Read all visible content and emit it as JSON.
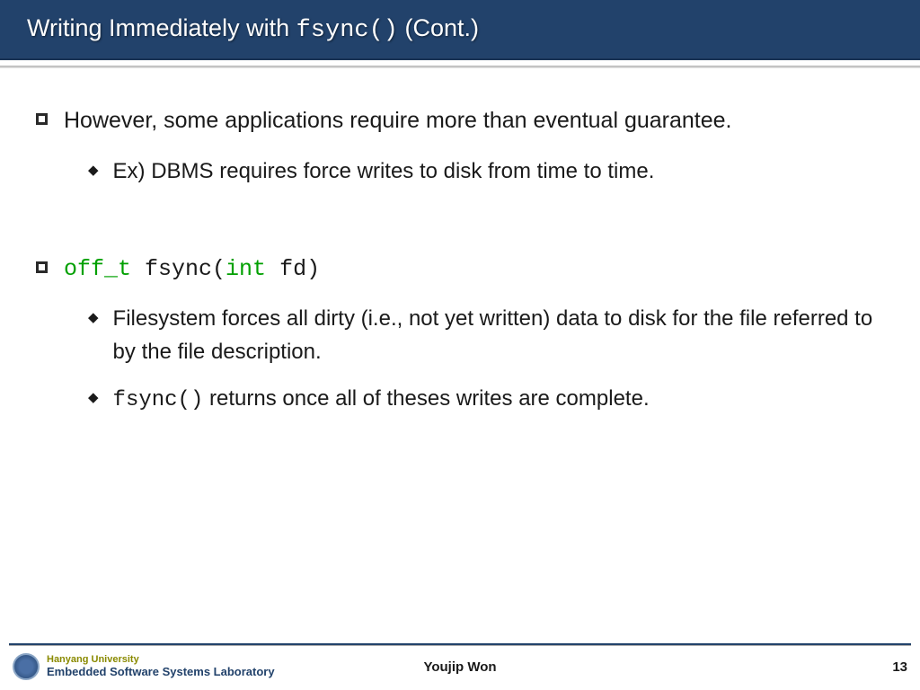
{
  "header": {
    "title_pre": "Writing Immediately with ",
    "title_code": "fsync()",
    "title_post": "  (Cont.)"
  },
  "content": {
    "item1": {
      "text": "However, some applications require more than eventual guarantee.",
      "sub1": "Ex) DBMS requires force writes to disk from time to time."
    },
    "item2": {
      "sig_type": "off_t",
      "sig_func": " fsync(",
      "sig_param_type": "int",
      "sig_rest": " fd)",
      "sub1": "Filesystem forces all dirty (i.e., not yet written) data to disk for the file referred to by the file description.",
      "sub2_code": "fsync()",
      "sub2_rest": " returns once all of theses writes are complete."
    }
  },
  "footer": {
    "university": "Hanyang University",
    "lab": "Embedded Software Systems Laboratory",
    "author": "Youjip Won",
    "page": "13"
  }
}
